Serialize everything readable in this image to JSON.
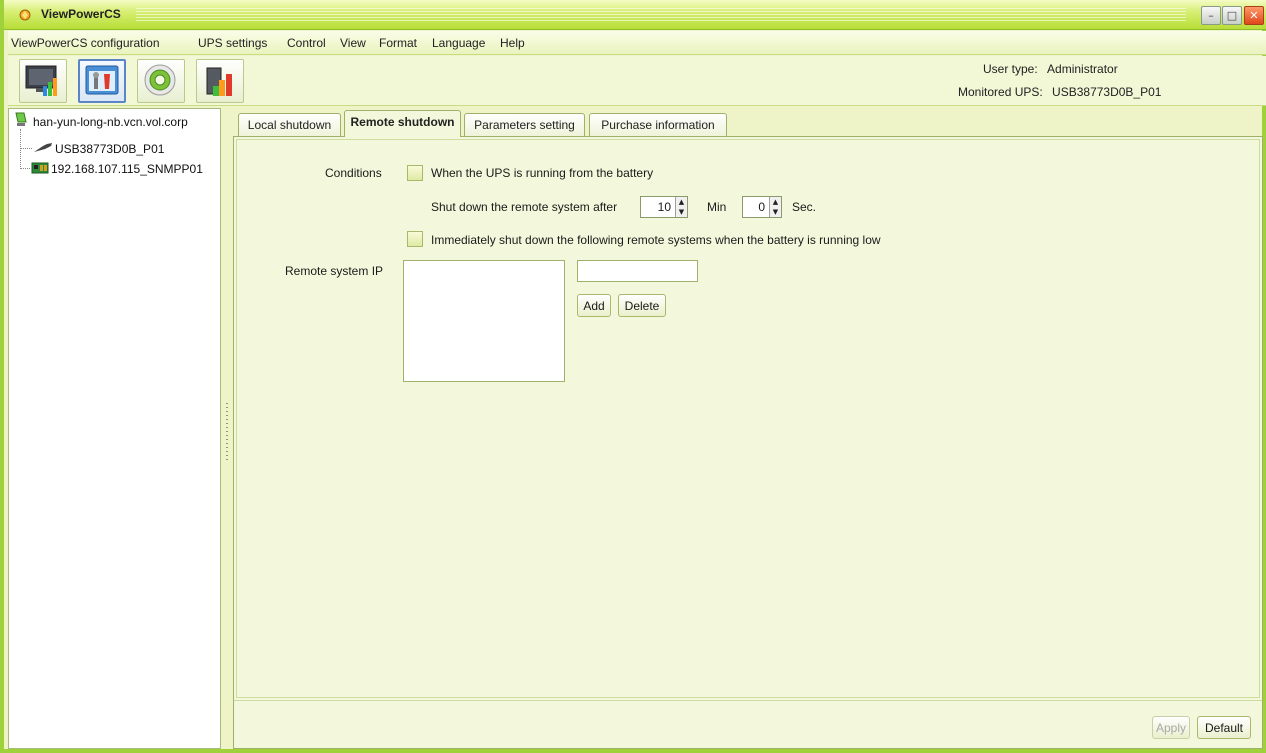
{
  "window": {
    "title": "ViewPowerCS"
  },
  "menu": {
    "items": [
      {
        "label": "ViewPowerCS  configuration"
      },
      {
        "label": "UPS settings"
      },
      {
        "label": "Control"
      },
      {
        "label": "View"
      },
      {
        "label": "Format"
      },
      {
        "label": "Language"
      },
      {
        "label": "Help"
      }
    ]
  },
  "toolbar": {
    "buttons": [
      {
        "icon": "monitor-chart-icon"
      },
      {
        "icon": "configuration-tools-icon",
        "active": true
      },
      {
        "icon": "control-gear-icon"
      },
      {
        "icon": "log-chart-icon"
      }
    ]
  },
  "user_info": {
    "user_type_label": "User type:",
    "user_type_value": "Administrator",
    "monitored_label": "Monitored UPS:",
    "monitored_value": "USB38773D0B_P01"
  },
  "tree": {
    "root": "han-yun-long-nb.vcn.vol.corp",
    "children": [
      {
        "label": "USB38773D0B_P01",
        "icon": "usb-cable-icon"
      },
      {
        "label": "192.168.107.115_SNMPP01",
        "icon": "snmp-card-icon"
      }
    ]
  },
  "tabs": [
    {
      "label": "Local shutdown"
    },
    {
      "label": "Remote shutdown",
      "active": true
    },
    {
      "label": "Parameters setting"
    },
    {
      "label": "Purchase information"
    }
  ],
  "remote_shutdown": {
    "conditions_label": "Conditions",
    "battery_condition_label": "When the UPS is running from the battery",
    "shutdown_after_label": "Shut down the remote system after",
    "minutes_value": "10",
    "minutes_unit": "Min",
    "seconds_value": "0",
    "seconds_unit": "Sec.",
    "low_battery_label": "Immediately shut down the following remote systems when the battery is running low",
    "remote_ip_label": "Remote system IP",
    "ip_input_value": "",
    "add_label": "Add",
    "delete_label": "Delete"
  },
  "footer": {
    "apply_label": "Apply",
    "default_label": "Default"
  },
  "colors": {
    "accent": "#b7dd36",
    "panel_bg": "#f3f8dc",
    "border": "#9fb06a"
  }
}
